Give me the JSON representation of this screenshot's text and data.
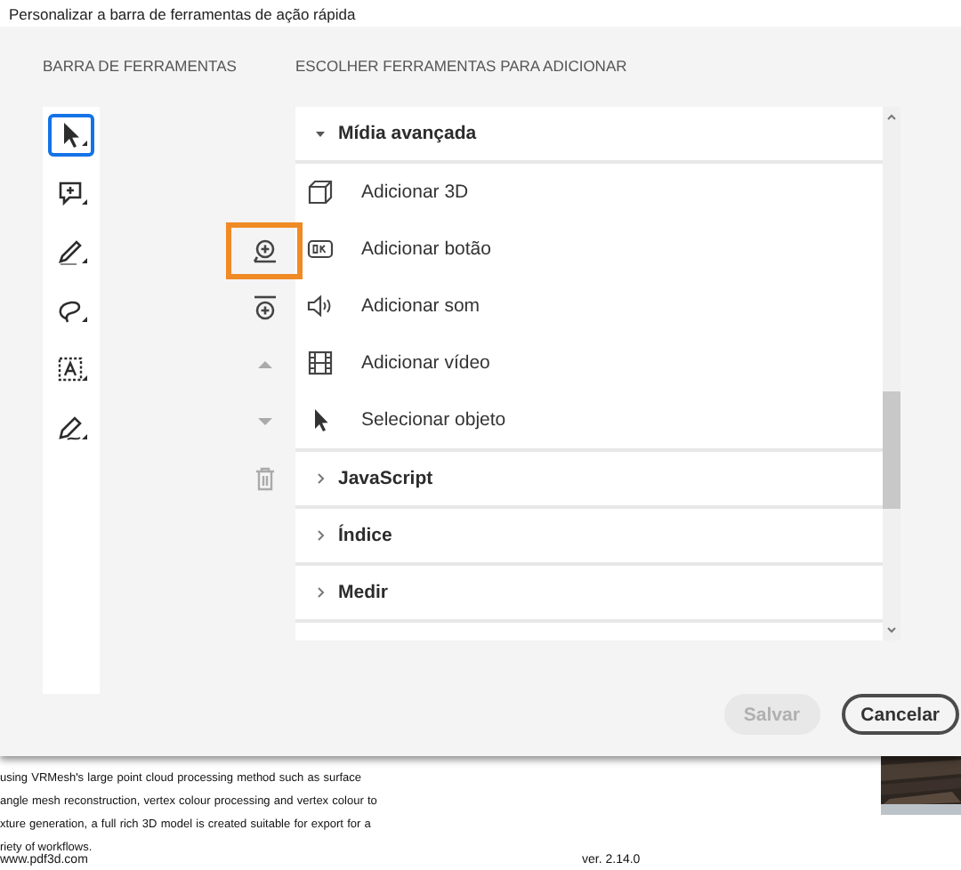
{
  "window": {
    "title": "Personalizar a barra de ferramentas de ação rápida"
  },
  "toolbar": {
    "heading": "BARRA DE FERRAMENTAS",
    "tools": [
      {
        "kind": "select",
        "selected": true
      },
      {
        "kind": "comment",
        "selected": false
      },
      {
        "kind": "pen",
        "selected": false
      },
      {
        "kind": "lasso",
        "selected": false
      },
      {
        "kind": "text-box",
        "selected": false
      },
      {
        "kind": "sign",
        "selected": false
      }
    ]
  },
  "actions": [
    {
      "kind": "add",
      "highlighted": true,
      "disabled": false
    },
    {
      "kind": "add-separator",
      "highlighted": false,
      "disabled": false
    },
    {
      "kind": "move-up",
      "highlighted": false,
      "disabled": true
    },
    {
      "kind": "move-down",
      "highlighted": false,
      "disabled": true
    },
    {
      "kind": "delete",
      "highlighted": false,
      "disabled": true
    }
  ],
  "chooser": {
    "heading": "ESCOLHER FERRAMENTAS PARA ADICIONAR",
    "groups": [
      {
        "label": "Mídia avançada",
        "expanded": true,
        "items": [
          {
            "label": "Adicionar 3D",
            "kind": "cube"
          },
          {
            "label": "Adicionar botão",
            "kind": "ok"
          },
          {
            "label": "Adicionar som",
            "kind": "sound"
          },
          {
            "label": "Adicionar vídeo",
            "kind": "film"
          },
          {
            "label": "Selecionar objeto",
            "kind": "cursor"
          }
        ]
      },
      {
        "label": "JavaScript",
        "expanded": false
      },
      {
        "label": "Índice",
        "expanded": false
      },
      {
        "label": "Medir",
        "expanded": false
      }
    ]
  },
  "buttons": [
    {
      "label": "Salvar",
      "disabled": true
    },
    {
      "label": "Cancelar",
      "disabled": false
    }
  ],
  "document": {
    "lines": [
      " using VRMesh's large point cloud processing method such as surface",
      "angle mesh reconstruction, vertex colour processing and vertex colour to",
      "xture generation, a full rich 3D model is created suitable for export for a",
      "riety of workflows."
    ],
    "footer_left": "www.pdf3d.com",
    "footer_right": "ver. 2.14.0"
  }
}
